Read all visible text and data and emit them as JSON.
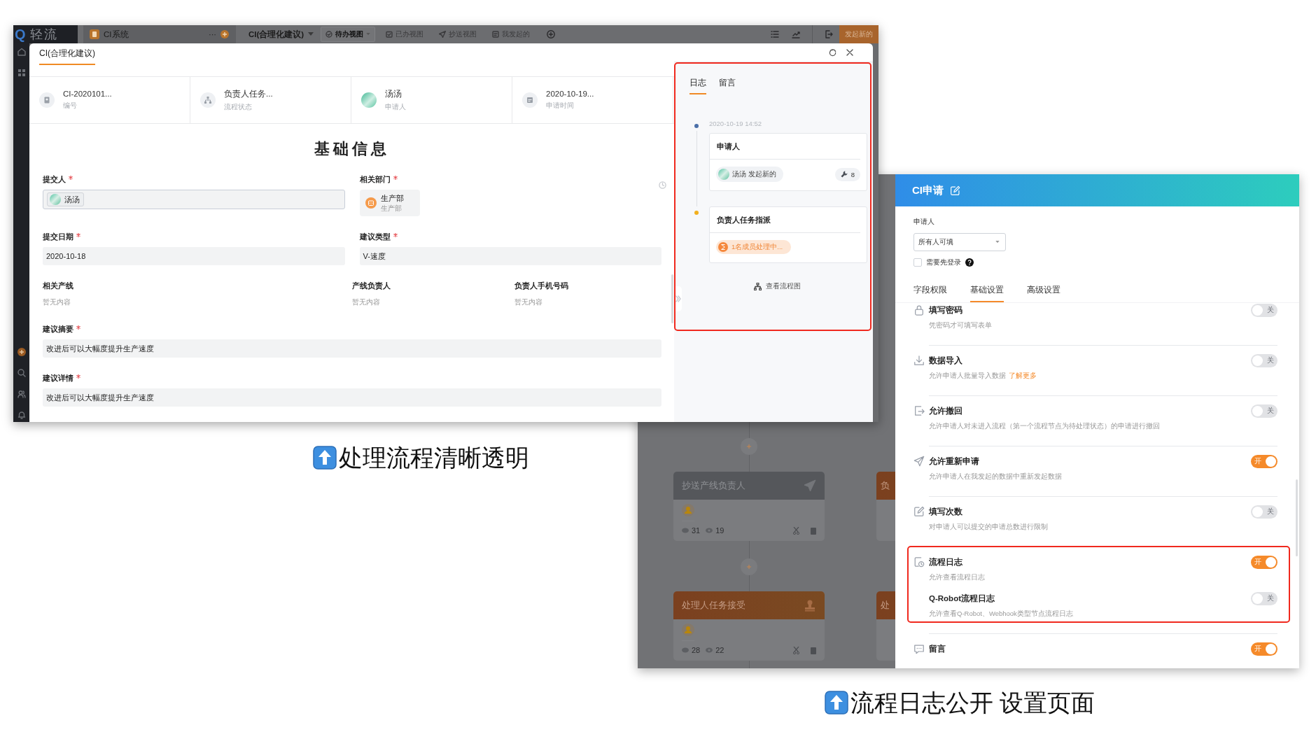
{
  "left_screenshot": {
    "app_bar": {
      "logo_mark": "Q",
      "logo": "轻流",
      "app": "CI系统",
      "more": "···",
      "form": "CI(合理化建议)",
      "new_button": "发起新的",
      "views": [
        {
          "label": "待办视图",
          "kind": "todo",
          "selected": true
        },
        {
          "label": "已办视图",
          "kind": "done",
          "selected": false
        },
        {
          "label": "抄送视图",
          "kind": "cc",
          "selected": false
        },
        {
          "label": "我发起的",
          "kind": "mine",
          "selected": false
        }
      ]
    },
    "modal": {
      "title": "CI(合理化建议)",
      "summary": [
        {
          "kind": "number",
          "value": "CI-2020101...",
          "label": "编号"
        },
        {
          "kind": "status",
          "value": "负责人任务...",
          "label": "流程状态"
        },
        {
          "kind": "avatar",
          "value": "汤汤",
          "label": "申请人"
        },
        {
          "kind": "time",
          "value": "2020-10-19...",
          "label": "申请时间"
        }
      ],
      "section_title": "基础信息",
      "field_rows": [
        [
          {
            "label": "提交人",
            "required": true,
            "kind": "member",
            "value": "汤汤"
          },
          {
            "label": "相关部门",
            "required": true,
            "kind": "dept",
            "value": "生产部",
            "sub": "生产部"
          }
        ],
        [
          {
            "label": "提交日期",
            "required": true,
            "kind": "text",
            "value": "2020-10-18"
          },
          {
            "label": "建议类型",
            "required": true,
            "kind": "text",
            "value": "V-速度"
          }
        ],
        [
          {
            "label": "相关产线",
            "required": false,
            "kind": "empty",
            "value": "暂无内容"
          },
          {
            "label": "产线负责人",
            "required": false,
            "kind": "empty",
            "value": "暂无内容"
          },
          {
            "label": "负责人手机号码",
            "required": false,
            "kind": "empty",
            "value": "暂无内容"
          }
        ],
        [
          {
            "label": "建议摘要",
            "required": true,
            "kind": "text",
            "value": "改进后可以大幅度提升生产速度"
          }
        ],
        [
          {
            "label": "建议详情",
            "required": true,
            "kind": "text",
            "value": "改进后可以大幅度提升生产速度"
          }
        ]
      ],
      "log": {
        "highlighted": true,
        "tabs": [
          {
            "label": "日志",
            "selected": true
          },
          {
            "label": "留言",
            "selected": false
          }
        ],
        "entries": [
          {
            "kind": "started",
            "color": "#4a6fa8",
            "time": "2020-10-19 14:52",
            "title": "申请人",
            "user": "汤汤 发起新的",
            "count": "8"
          },
          {
            "kind": "pending",
            "color": "#f2b01e",
            "title": "负责人任务指派",
            "status": "1名成员处理中..."
          }
        ],
        "flow_link": "查看流程图"
      }
    }
  },
  "caption_left": "处理流程清晰透明",
  "right_screenshot": {
    "flow_cards": [
      {
        "kind": "cc",
        "title": "抄送产线负责人",
        "comments": "31",
        "views": "19"
      },
      {
        "kind": "task",
        "title": "处理人任务接受",
        "comments": "28",
        "views": "22"
      }
    ],
    "partial_cards": [
      {
        "kind": "task",
        "title": "负"
      },
      {
        "kind": "task",
        "title": "处"
      }
    ],
    "settings": {
      "title": "CI申请",
      "applicant_label": "申请人",
      "applicant_select": "所有人可填",
      "login_required": {
        "label": "需要先登录",
        "checked": false
      },
      "tabs": [
        {
          "label": "字段权限",
          "selected": false
        },
        {
          "label": "基础设置",
          "selected": true
        },
        {
          "label": "高级设置",
          "selected": false
        }
      ],
      "rows": [
        {
          "kind": "password",
          "title": "填写密码",
          "description": "凭密码才可填写表单",
          "on": false,
          "switch_label": "关"
        },
        {
          "kind": "import",
          "title": "数据导入",
          "description": "允许申请人批量导入数据",
          "link": "了解更多",
          "on": false,
          "switch_label": "关"
        },
        {
          "kind": "withdraw",
          "title": "允许撤回",
          "description": "允许申请人对未进入流程（第一个流程节点为待处理状态）的申请进行撤回",
          "on": false,
          "switch_label": "关"
        },
        {
          "kind": "reapply",
          "title": "允许重新申请",
          "description": "允许申请人在我发起的数据中重新发起数据",
          "on": true,
          "switch_label": "开"
        },
        {
          "kind": "count",
          "title": "填写次数",
          "description": "对申请人可以提交的申请总数进行限制",
          "on": false,
          "switch_label": "关"
        },
        {
          "kind": "log",
          "title": "流程日志",
          "description": "允许查看流程日志",
          "on": true,
          "switch_label": "开",
          "highlighted": true,
          "sub_items": [
            {
              "title": "Q-Robot流程日志",
              "description": "允许查看Q-Robot、Webhook类型节点流程日志",
              "on": false,
              "switch_label": "关"
            }
          ]
        },
        {
          "kind": "message",
          "title": "留言",
          "on": true,
          "switch_label": "开"
        }
      ]
    }
  },
  "caption_right": "流程日志公开 设置页面"
}
